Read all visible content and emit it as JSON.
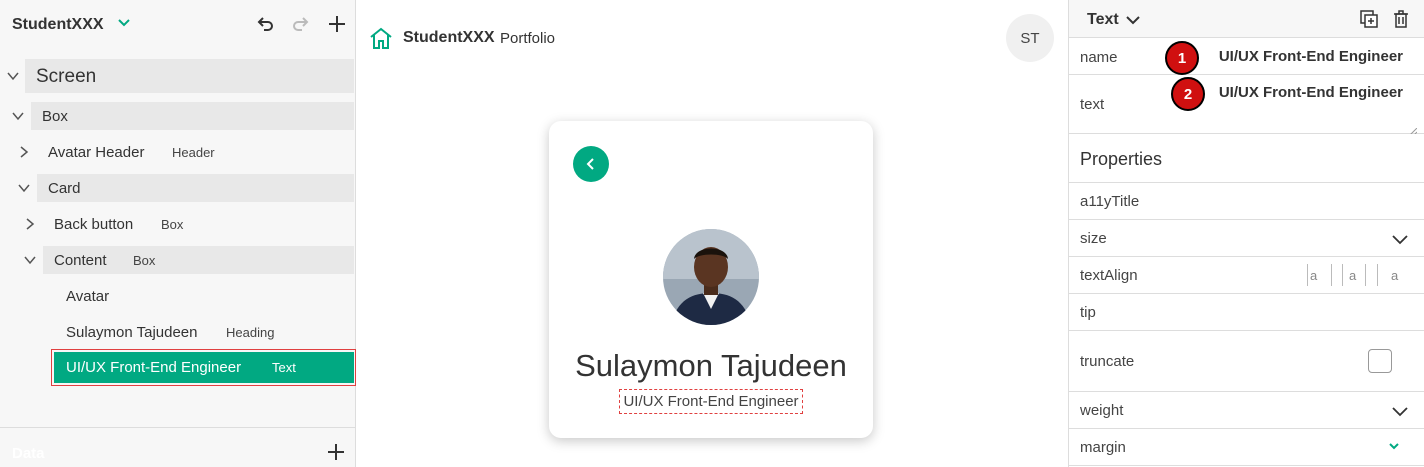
{
  "left_panel": {
    "app_name": "StudentXXX",
    "tree": [
      {
        "label": "Screen",
        "tag": ""
      },
      {
        "label": "Box",
        "tag": ""
      },
      {
        "label": "Avatar Header",
        "tag": "Header"
      },
      {
        "label": "Card",
        "tag": ""
      },
      {
        "label": "Back button",
        "tag": "Box"
      },
      {
        "label": "Content",
        "tag": "Box"
      },
      {
        "label": "Avatar",
        "tag": ""
      },
      {
        "label": "Sulaymon Tajudeen",
        "tag": "Heading"
      },
      {
        "label": "UI/UX Front-End Engineer",
        "tag": "Text"
      }
    ],
    "data_label": "Data"
  },
  "canvas": {
    "brand_name": "StudentXXX",
    "brand_sub": "Portfolio",
    "user_initials": "ST",
    "card": {
      "name": "Sulaymon Tajudeen",
      "role": "UI/UX Front-End Engineer"
    }
  },
  "right_panel": {
    "title": "Text",
    "name_label": "name",
    "name_value": "UI/UX Front-End Engineer",
    "text_label": "text",
    "text_value": "UI/UX Front-End Engineer",
    "badge_1": "1",
    "badge_2": "2",
    "properties_title": "Properties",
    "props": {
      "a11y": "a11yTitle",
      "size": "size",
      "textAlign": "textAlign",
      "tip": "tip",
      "truncate": "truncate",
      "weight": "weight",
      "margin": "margin"
    },
    "align_glyph": "a"
  },
  "colors": {
    "accent": "#01a982",
    "selection_border": "#e04040",
    "badge": "#d01010"
  }
}
